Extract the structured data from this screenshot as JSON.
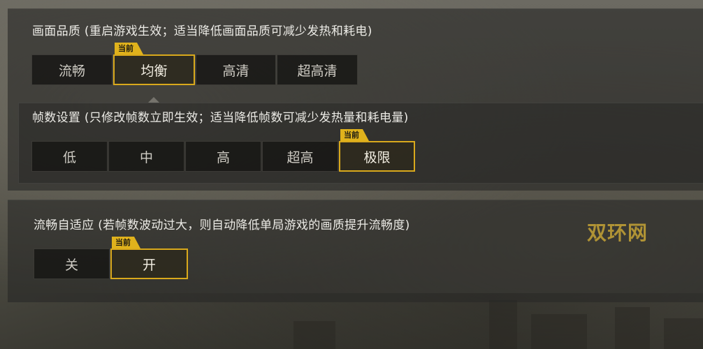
{
  "graphics_quality": {
    "label": "画面品质 (重启游戏生效；适当降低画面品质可减少发热和耗电)",
    "current_badge": "当前",
    "options": [
      "流畅",
      "均衡",
      "高清",
      "超高清"
    ],
    "selected_index": 1
  },
  "frame_rate": {
    "label": "帧数设置 (只修改帧数立即生效；适当降低帧数可减少发热量和耗电量)",
    "current_badge": "当前",
    "options": [
      "低",
      "中",
      "高",
      "超高",
      "极限"
    ],
    "selected_index": 4
  },
  "smooth_adaptive": {
    "label": "流畅自适应 (若帧数波动过大，则自动降低单局游戏的画质提升流畅度)",
    "current_badge": "当前",
    "options": [
      "关",
      "开"
    ],
    "selected_index": 1
  },
  "watermark": "双环网",
  "colors": {
    "accent": "#d9a91c",
    "badge_bg": "#e0b21c",
    "panel_bg": "#282826",
    "option_bg": "#161614"
  }
}
